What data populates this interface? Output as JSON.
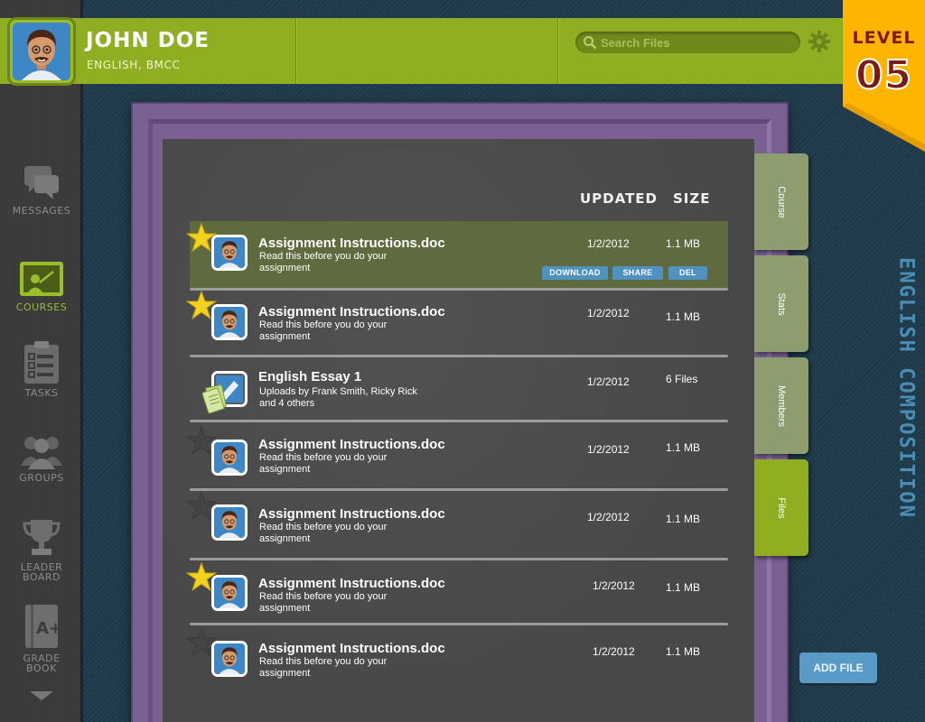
{
  "user": {
    "name": "JOHN DOE",
    "subtitle": "ENGLISH, BMCC",
    "avatar": "avatar-icon"
  },
  "search": {
    "placeholder": "Search Files",
    "value": ""
  },
  "level": {
    "label": "LEVEL",
    "number": "05"
  },
  "nav": {
    "items": [
      {
        "label": "MESSAGES",
        "icon": "chat-bubbles-icon",
        "active": false
      },
      {
        "label": "COURSES",
        "icon": "chalkboard-icon",
        "active": true
      },
      {
        "label": "TASKS",
        "icon": "clipboard-checklist-icon",
        "active": false
      },
      {
        "label": "GROUPS",
        "icon": "people-icon",
        "active": false
      },
      {
        "label": "LEADER",
        "label2": "BOARD",
        "icon": "trophy-icon",
        "active": false
      },
      {
        "label": "GRADE",
        "label2": "BOOK",
        "icon": "grade-book-icon",
        "active": false
      }
    ]
  },
  "table": {
    "headers": {
      "updated": "UPDATED",
      "size": "SIZE"
    },
    "rows": [
      {
        "title": "Assignment Instructions.doc",
        "desc": "Read this before you do your assignment",
        "date": "1/2/2012",
        "size": "1.1 MB",
        "starred": true,
        "selected": true
      },
      {
        "title": "Assignment Instructions.doc",
        "desc": "Read this before you do your assignment",
        "date": "1/2/2012",
        "size": "1.1 MB",
        "starred": true,
        "selected": false
      },
      {
        "title": "English Essay 1",
        "desc": "Uploads by Frank Smith, Ricky Rick and 4 others",
        "date": "1/2/2012",
        "size": "6 Files",
        "starred": false,
        "folder": true
      },
      {
        "title": "Assignment Instructions.doc",
        "desc": "Read this before you do your assignment",
        "date": "1/2/2012",
        "size": "1.1 MB",
        "starred": false
      },
      {
        "title": "Assignment Instructions.doc",
        "desc": "Read this before you do your assignment",
        "date": "1/2/2012",
        "size": "1.1 MB",
        "starred": false
      },
      {
        "title": "Assignment Instructions.doc",
        "desc": "Read this before you do your assignment",
        "date": "1/2/2012",
        "size": "1.1 MB",
        "starred": true
      },
      {
        "title": "Assignment Instructions.doc",
        "desc": "Read this before you do your assignment",
        "date": "1/2/2012",
        "size": "1.1 MB",
        "starred": false
      }
    ],
    "actions": {
      "download": "DOWNLOAD",
      "share": "SHARE",
      "delete": "DEL"
    }
  },
  "tabs": [
    {
      "label": "Course",
      "active": false
    },
    {
      "label": "Stats",
      "active": false
    },
    {
      "label": "Members",
      "active": false
    },
    {
      "label": "Files",
      "active": true
    }
  ],
  "course_title": "ENGLISH COMPOSITION",
  "add_file_label": "ADD FILE",
  "colors": {
    "header": "#8fae21",
    "frame": "#7b6094",
    "board": "#484848",
    "badge": "#ffb400",
    "badge_text": "#7a1a1a",
    "accent_blue": "#4f92c0"
  }
}
